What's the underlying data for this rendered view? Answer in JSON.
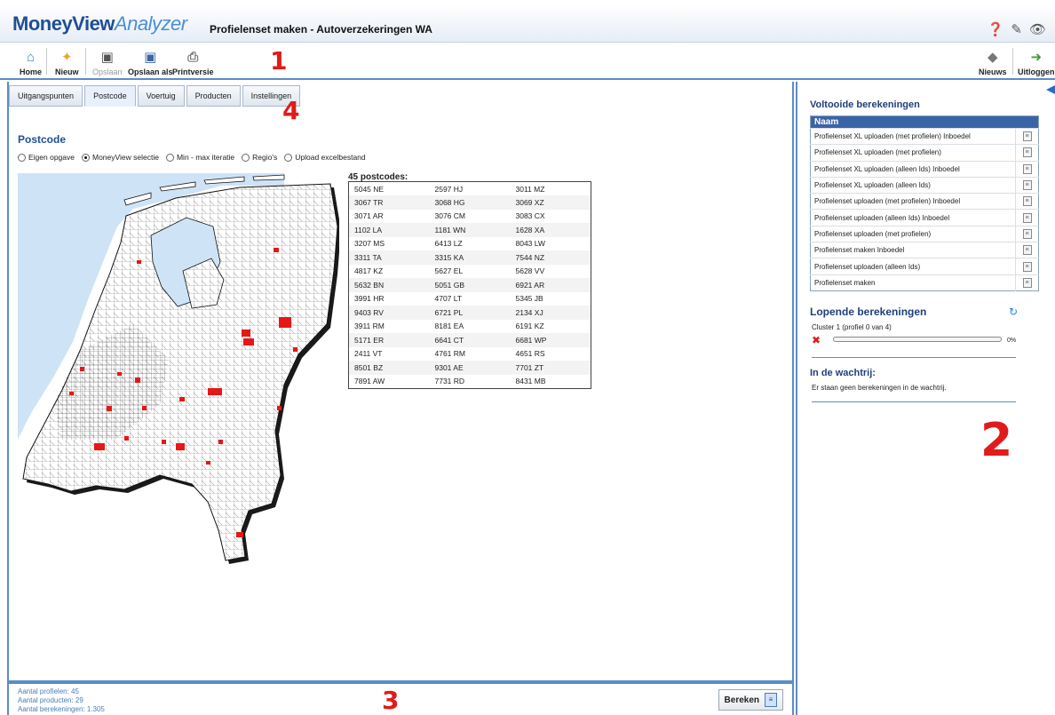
{
  "app": {
    "logo_part1": "MoneyView",
    "logo_part2": "Analyzer",
    "title": "Profielenset maken - Autoverzekeringen WA"
  },
  "header_icons": [
    "help-icon",
    "tools-icon",
    "eye-icon"
  ],
  "toolbar": {
    "home": "Home",
    "new": "Nieuw",
    "save": "Opslaan",
    "save_as": "Opslaan als",
    "print": "Printversie",
    "news": "Nieuws",
    "logout": "Uitloggen"
  },
  "annotations": {
    "n1": "1",
    "n2": "2",
    "n3": "3",
    "n4": "4"
  },
  "tabs": [
    "Uitgangspunten",
    "Postcode",
    "Voertuig",
    "Producten",
    "Instellingen"
  ],
  "active_tab": "Postcode",
  "postcode": {
    "title": "Postcode",
    "options": [
      "Eigen opgave",
      "MoneyView selectie",
      "Min - max iteratie",
      "Regio's",
      "Upload excelbestand"
    ],
    "selected_option": "MoneyView selectie",
    "list_label": "45 postcodes:",
    "rows": [
      [
        "5045 NE",
        "2597 HJ",
        "3011 MZ"
      ],
      [
        "3067 TR",
        "3068 HG",
        "3069 XZ"
      ],
      [
        "3071 AR",
        "3076 CM",
        "3083 CX"
      ],
      [
        "1102 LA",
        "1181 WN",
        "1628 XA"
      ],
      [
        "3207 MS",
        "6413 LZ",
        "8043 LW"
      ],
      [
        "3311 TA",
        "3315 KA",
        "7544 NZ"
      ],
      [
        "4817 KZ",
        "5627 EL",
        "5628 VV"
      ],
      [
        "5632 BN",
        "5051 GB",
        "6921 AR"
      ],
      [
        "3991 HR",
        "4707 LT",
        "5345 JB"
      ],
      [
        "9403 RV",
        "6721 PL",
        "2134 XJ"
      ],
      [
        "3911 RM",
        "8181 EA",
        "6191 KZ"
      ],
      [
        "5171 ER",
        "6641 CT",
        "6681 WP"
      ],
      [
        "2411 VT",
        "4761 RM",
        "4651 RS"
      ],
      [
        "8501 BZ",
        "9301 AE",
        "7701 ZT"
      ],
      [
        "7891 AW",
        "7731 RD",
        "8431 MB"
      ]
    ]
  },
  "footer": {
    "stats": [
      "Aantal profielen: 45",
      "Aantal producten: 29",
      "Aantal berekeningen: 1.305"
    ],
    "calc_button": "Bereken"
  },
  "right": {
    "done_title": "Voltooide berekeningen",
    "done_col": "Naam",
    "done_items": [
      "Profielenset XL uploaden (met profielen) Inboedel",
      "Profielenset XL uploaden (met profielen)",
      "Profielenset XL uploaden (alleen Ids) Inboedel",
      "Profielenset XL uploaden (alleen Ids)",
      "Profielenset uploaden (met profielen) Inboedel",
      "Profielenset uploaden (alleen Ids) Inboedel",
      "Profielenset uploaden (met profielen)",
      "Profielenset maken Inboedel",
      "Profielenset uploaden (alleen Ids)",
      "Profielenset maken"
    ],
    "running_title": "Lopende berekeningen",
    "running_item": "Cluster 1 (profiel 0 van 4)",
    "progress_pct": "0%",
    "progress_fraction": 0,
    "queue_title": "In de wachtrij:",
    "queue_text": "Er staan geen berekeningen in de wachtrij."
  },
  "colors": {
    "accent": "#5b8cc6",
    "annotation": "#e01b1b",
    "header_text": "#1f4f93"
  }
}
